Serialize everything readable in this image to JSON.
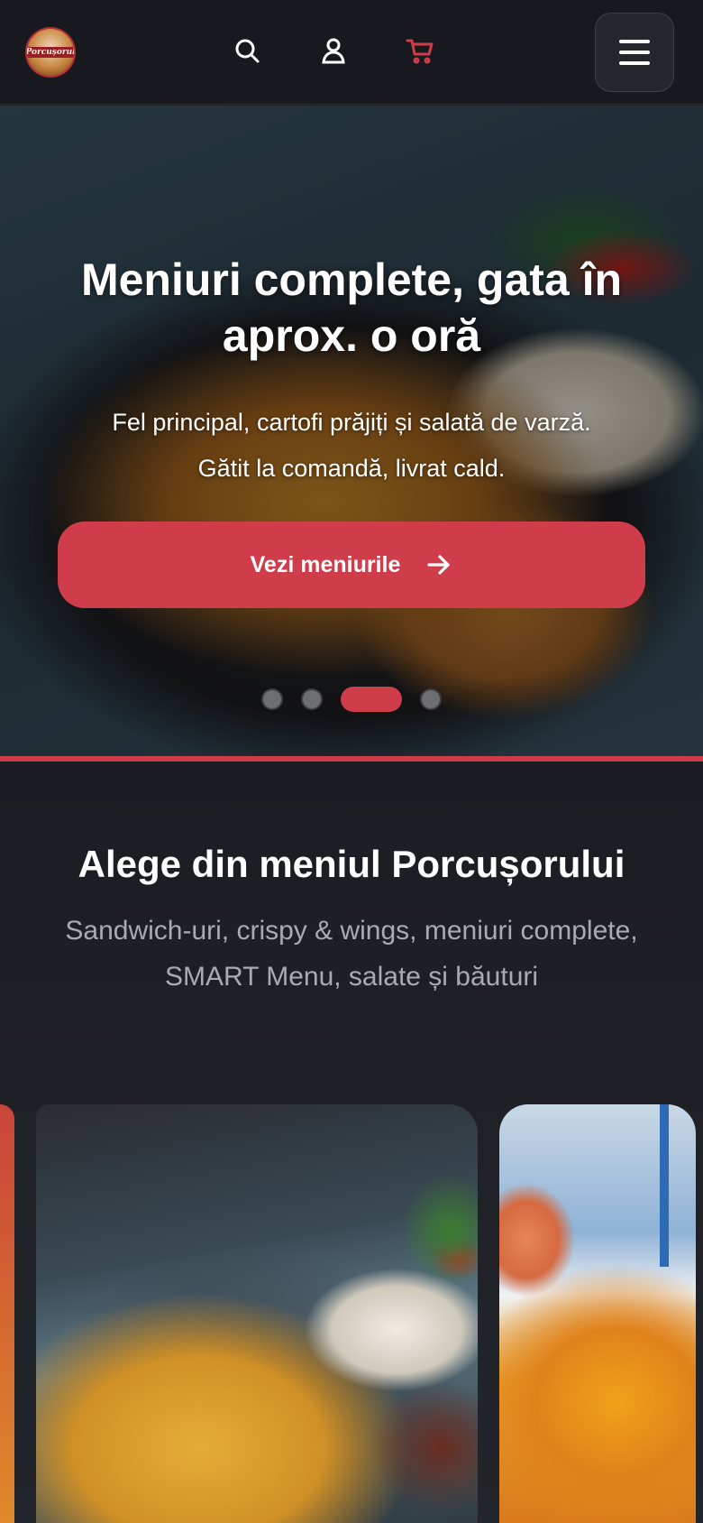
{
  "header": {
    "logo_text": "Porcușorul",
    "icons": [
      "search-icon",
      "user-icon",
      "cart-icon",
      "menu-icon"
    ],
    "accent_color": "#d03d4a"
  },
  "hero": {
    "title": "Meniuri complete, gata în aprox. o oră",
    "subtitle_line1": "Fel principal, cartofi prăjiți și salată de varză.",
    "subtitle_line2": "Gătit la comandă, livrat cald.",
    "cta_label": "Vezi meniurile",
    "slides_count": 4,
    "active_slide": 3
  },
  "menu_section": {
    "title": "Alege din meniul Porcușorului",
    "subtitle": "Sandwich-uri, crispy & wings, meniuri complete, SMART Menu, salate și băuturi"
  }
}
